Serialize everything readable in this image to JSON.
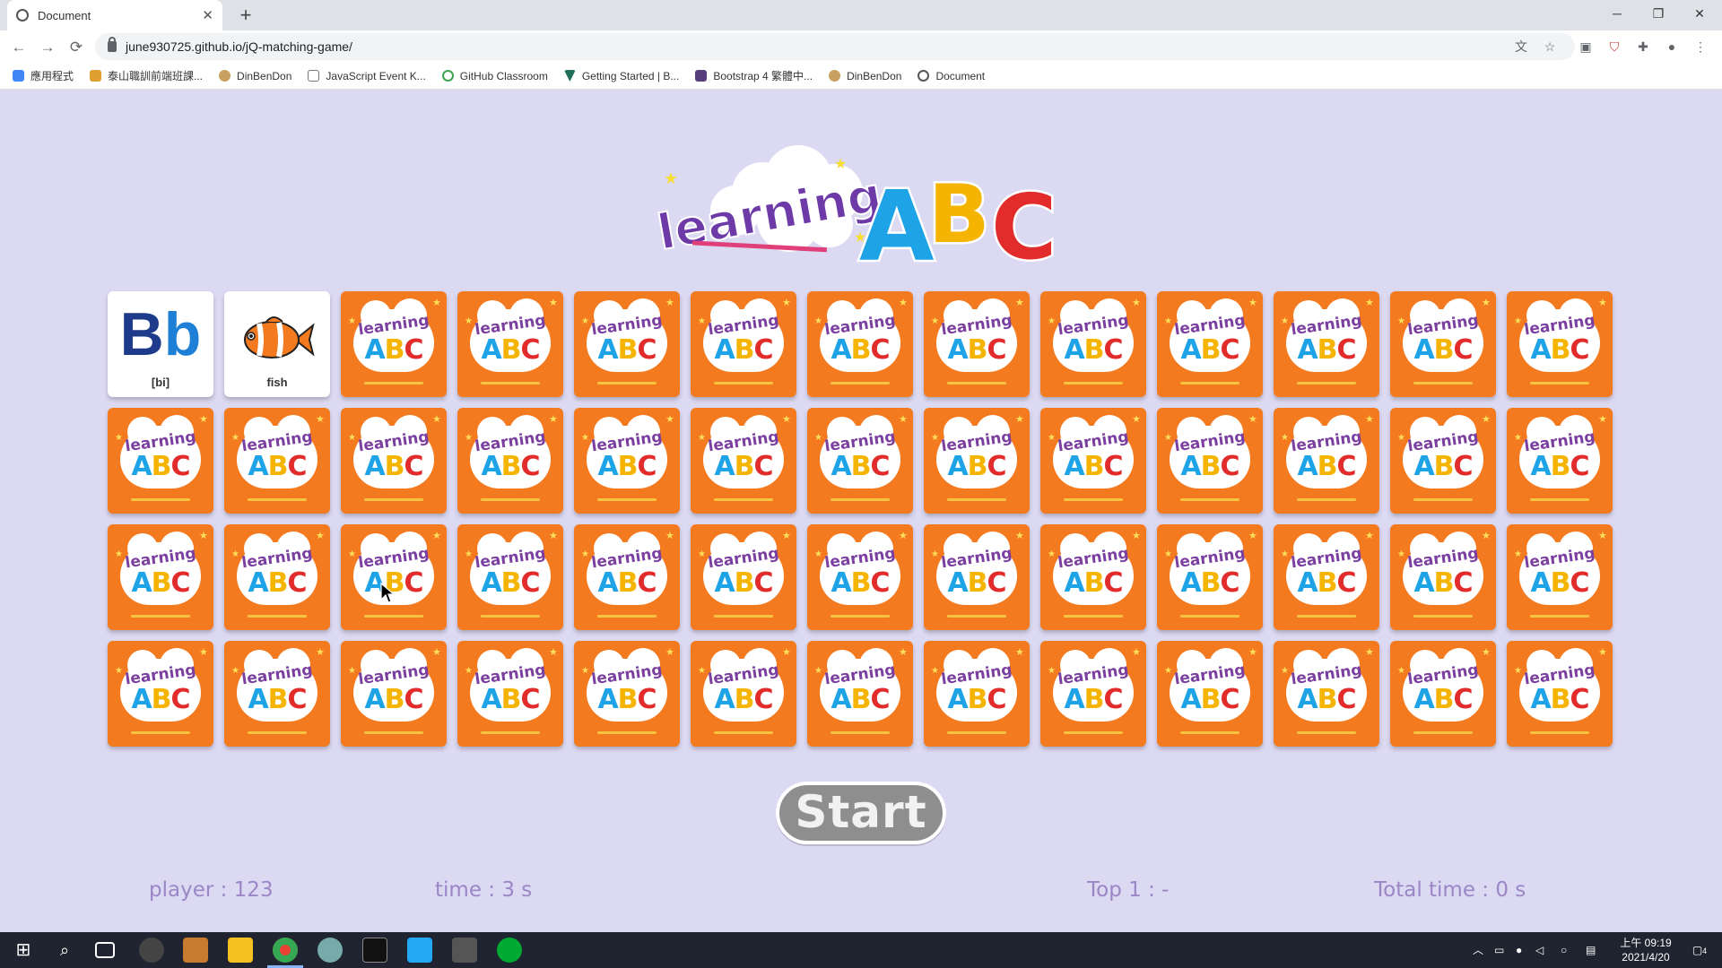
{
  "browser": {
    "tab_title": "Document",
    "tab_close": "✕",
    "new_tab": "+",
    "url": "june930725.github.io/jQ-matching-game/",
    "window_controls": {
      "minimize": "─",
      "restore": "❐",
      "close": "✕"
    },
    "nav": {
      "back": "←",
      "forward": "→",
      "reload": "⟳"
    },
    "bookmarks": [
      {
        "label": "應用程式",
        "color": "#4285f4"
      },
      {
        "label": "泰山職訓前端班課...",
        "color": "#e0a030"
      },
      {
        "label": "DinBenDon",
        "color": "#c8a060"
      },
      {
        "label": "JavaScript Event K...",
        "color": "#777777"
      },
      {
        "label": "GitHub Classroom",
        "color": "#3ea44e"
      },
      {
        "label": "Getting Started | B...",
        "color": "#1f6f5a"
      },
      {
        "label": "Bootstrap 4 繁體中...",
        "color": "#563d7c"
      },
      {
        "label": "DinBenDon",
        "color": "#c8a060"
      },
      {
        "label": "Document",
        "color": "#555555"
      }
    ]
  },
  "game": {
    "logo": {
      "word": "learning",
      "letters": [
        "A",
        "B",
        "C"
      ]
    },
    "card_back": {
      "word": "learning",
      "letters": [
        "A",
        "B",
        "C"
      ]
    },
    "grid": {
      "columns": 13,
      "rows": 4,
      "total_cards": 52
    },
    "revealed_cards": [
      {
        "index": 0,
        "type": "letter",
        "upper": "B",
        "lower": "b",
        "caption": "[bi]"
      },
      {
        "index": 1,
        "type": "picture",
        "picture": "clownfish",
        "caption": "fish"
      }
    ],
    "start_button": "Start",
    "stats": {
      "player": "player : 123",
      "time": "time : 3 s",
      "top": "Top 1 : -",
      "total_time": "Total time : 0 s"
    }
  },
  "taskbar": {
    "clock_time": "上午 09:19",
    "clock_date": "2021/4/20",
    "notification_count": "4"
  }
}
